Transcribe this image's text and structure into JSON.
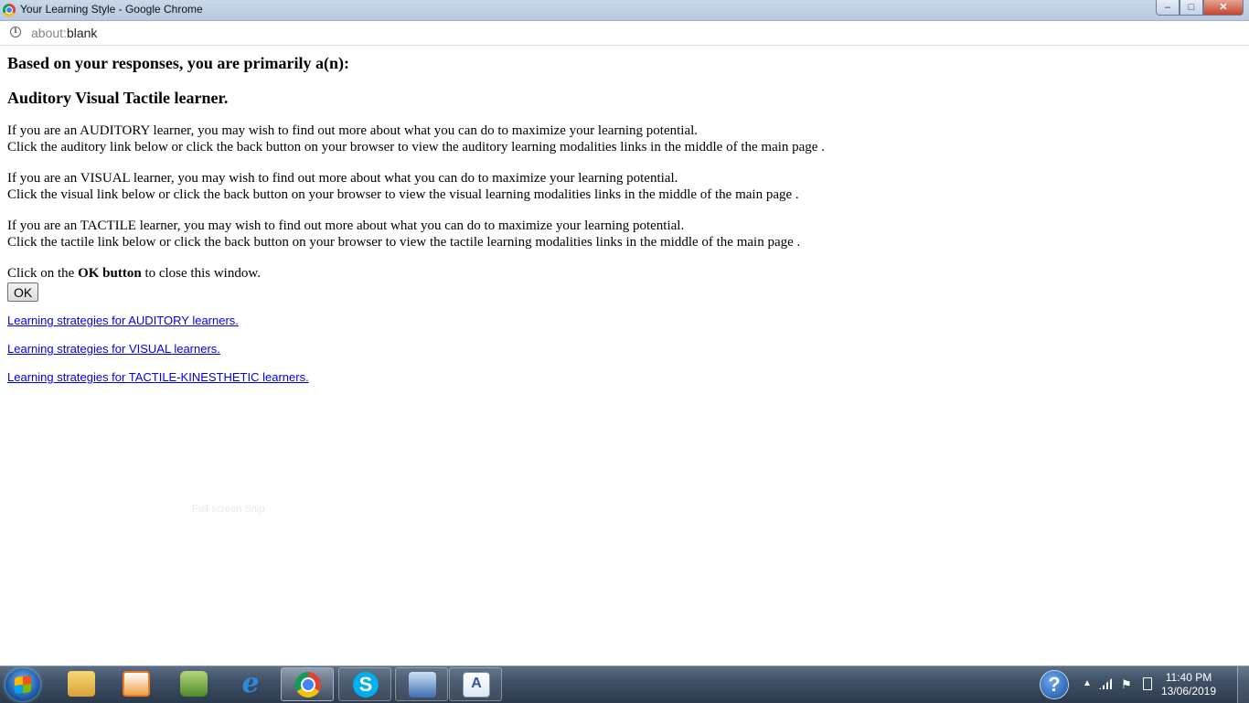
{
  "window": {
    "title": "Your Learning Style - Google Chrome",
    "controls": {
      "minimize": "‒",
      "maximize": "□",
      "close": "✕"
    }
  },
  "address_bar": {
    "url_scheme": "about:",
    "url_rest": "blank"
  },
  "page": {
    "heading": "Based on your responses, you are primarily a(n):",
    "result": "Auditory Visual Tactile learner.",
    "paragraphs": [
      {
        "line1": "If you are an AUDITORY learner, you may wish to find out more about what you can do to maximize your learning potential.",
        "line2": "Click the auditory link below or click the back button on your browser to view the auditory learning modalities links in the middle of the main page ."
      },
      {
        "line1": "If you are an VISUAL learner, you may wish to find out more about what you can do to maximize your learning potential.",
        "line2": "Click the visual link below or click the back button on your browser to view the visual learning modalities links in the middle of the main page ."
      },
      {
        "line1": "If you are an TACTILE learner, you may wish to find out more about what you can do to maximize your learning potential.",
        "line2": "Click the tactile link below or click the back button on your browser to view the tactile learning modalities links in the middle of the main page ."
      }
    ],
    "close_prefix": "Click on the ",
    "close_bold": "OK button",
    "close_suffix": " to close this window.",
    "ok_label": "OK",
    "links": [
      "Learning strategies for AUDITORY learners.",
      "Learning strategies for VISUAL learners.",
      "Learning strategies for TACTILE-KINESTHETIC learners."
    ],
    "ghost_text": "Full-screen Snip"
  },
  "taskbar": {
    "items": [
      {
        "name": "windows-explorer",
        "icon": "folder-icon"
      },
      {
        "name": "media-player",
        "icon": "media-player-icon"
      },
      {
        "name": "leaf-app",
        "icon": "leaf-icon"
      },
      {
        "name": "internet-explorer",
        "icon": "ie-icon",
        "glyph": "e"
      },
      {
        "name": "google-chrome",
        "icon": "chrome-icon",
        "active": true
      },
      {
        "name": "skype",
        "icon": "skype-icon",
        "glyph": "S"
      },
      {
        "name": "network-app",
        "icon": "network-icon"
      },
      {
        "name": "document-app",
        "icon": "document-icon",
        "glyph": "A"
      }
    ],
    "tray": {
      "help_glyph": "?",
      "time": "11:40 PM",
      "date": "13/06/2019"
    }
  }
}
